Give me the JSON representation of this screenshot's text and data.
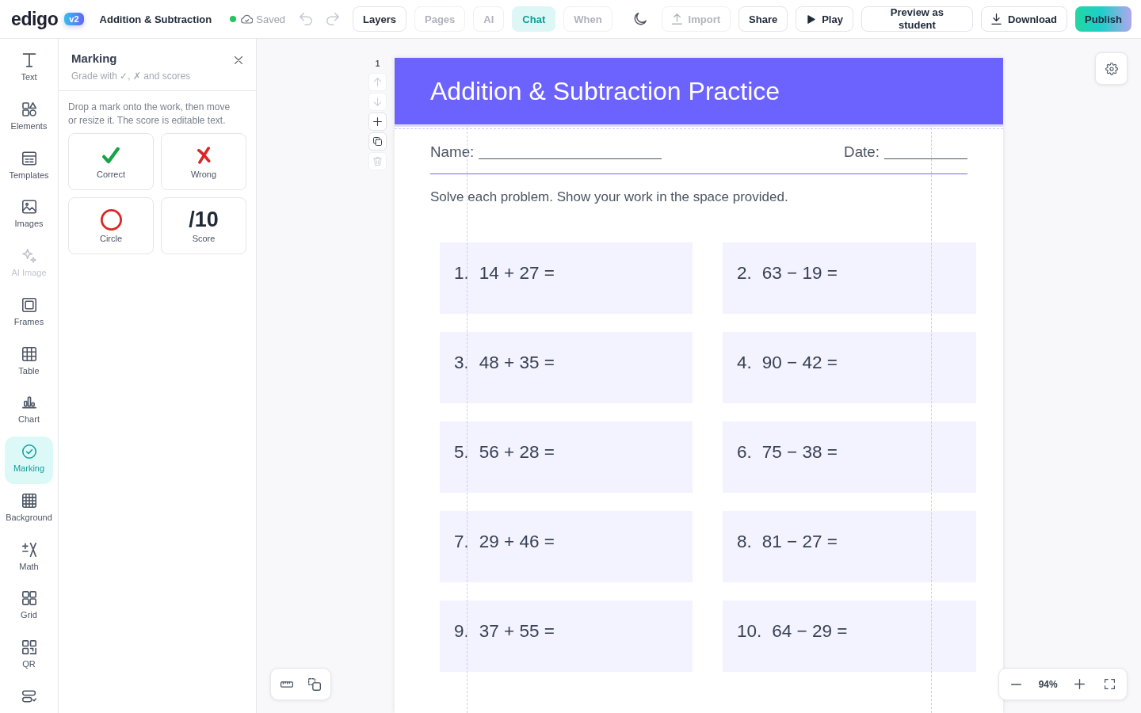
{
  "top_bar": {
    "logo": "edigo",
    "version_badge": "v2",
    "document_title": "Addition & Subtraction",
    "save_status": "Saved",
    "history": [
      {
        "kind": "undo",
        "disabled": true
      },
      {
        "kind": "redo",
        "disabled": true
      }
    ],
    "tabs": [
      {
        "label": "Layers",
        "selected": false,
        "disabled": false
      },
      {
        "label": "Pages",
        "selected": false,
        "disabled": true
      },
      {
        "label": "AI",
        "selected": false,
        "disabled": true
      },
      {
        "label": "Chat",
        "selected": true,
        "disabled": false
      },
      {
        "label": "When",
        "selected": false,
        "disabled": true
      }
    ],
    "actions": [
      {
        "kind": "import",
        "label": "Import",
        "disabled": true
      },
      {
        "kind": "share",
        "label": "Share",
        "disabled": false
      },
      {
        "kind": "play",
        "label": "Play",
        "disabled": false
      },
      {
        "kind": "preview",
        "label": "Preview as student",
        "disabled": false
      },
      {
        "kind": "download",
        "label": "Download",
        "disabled": false
      },
      {
        "kind": "publish",
        "label": "Publish",
        "disabled": false
      }
    ]
  },
  "tool_rail": {
    "items": [
      {
        "kind": "text",
        "label": "Text",
        "selected": false,
        "disabled": false
      },
      {
        "kind": "elements",
        "label": "Elements",
        "selected": false,
        "disabled": false
      },
      {
        "kind": "templates",
        "label": "Templates",
        "selected": false,
        "disabled": false
      },
      {
        "kind": "images",
        "label": "Images",
        "selected": false,
        "disabled": false
      },
      {
        "kind": "ai_image",
        "label": "AI Image",
        "selected": false,
        "disabled": true
      },
      {
        "kind": "frames",
        "label": "Frames",
        "selected": false,
        "disabled": false
      },
      {
        "kind": "table",
        "label": "Table",
        "selected": false,
        "disabled": false
      },
      {
        "kind": "chart",
        "label": "Chart",
        "selected": false,
        "disabled": false
      },
      {
        "kind": "marking",
        "label": "Marking",
        "selected": true,
        "disabled": false
      },
      {
        "kind": "background",
        "label": "Background",
        "selected": false,
        "disabled": false
      },
      {
        "kind": "math",
        "label": "Math",
        "selected": false,
        "disabled": false
      },
      {
        "kind": "grid",
        "label": "Grid",
        "selected": false,
        "disabled": false
      },
      {
        "kind": "qr",
        "label": "QR",
        "selected": false,
        "disabled": false
      },
      {
        "kind": "forms",
        "selected": false,
        "disabled": false
      }
    ]
  },
  "marking_panel": {
    "title": "Marking",
    "subtitle": "Grade with ✓, ✗ and scores",
    "hint": "Drop a mark onto the work, then move or resize it. The score is editable text.",
    "mark_rows": [
      {
        "marks": [
          {
            "kind": "check",
            "label": "Correct"
          },
          {
            "kind": "cross",
            "label": "Wrong"
          }
        ]
      },
      {
        "marks": [
          {
            "kind": "circle",
            "label": "Circle"
          },
          {
            "kind": "score",
            "text": "/10",
            "label": "Score"
          }
        ]
      }
    ]
  },
  "canvas": {
    "page_number": "1",
    "page_buttons": [
      {
        "kind": "up",
        "disabled": true
      },
      {
        "kind": "down",
        "disabled": true
      },
      {
        "kind": "add",
        "disabled": false
      },
      {
        "kind": "duplicate",
        "disabled": false
      },
      {
        "kind": "delete",
        "disabled": true
      }
    ],
    "worksheet": {
      "title": "Addition & Subtraction Practice",
      "name_label": "Name:",
      "date_label": "Date:",
      "instructions": "Solve each problem. Show your work in the space provided.",
      "problems": [
        {
          "number": "1.",
          "expression": "14 + 27 ="
        },
        {
          "number": "2.",
          "expression": "63 − 19 ="
        },
        {
          "number": "3.",
          "expression": "48 + 35 ="
        },
        {
          "number": "4.",
          "expression": "90 − 42 ="
        },
        {
          "number": "5.",
          "expression": "56 + 28 ="
        },
        {
          "number": "6.",
          "expression": "75 − 38 ="
        },
        {
          "number": "7.",
          "expression": "29 + 46 ="
        },
        {
          "number": "8.",
          "expression": "81 − 27 ="
        },
        {
          "number": "9.",
          "expression": "37 + 55 ="
        },
        {
          "number": "10.",
          "expression": "64 − 29 ="
        }
      ]
    },
    "zoom_level": "94%"
  }
}
